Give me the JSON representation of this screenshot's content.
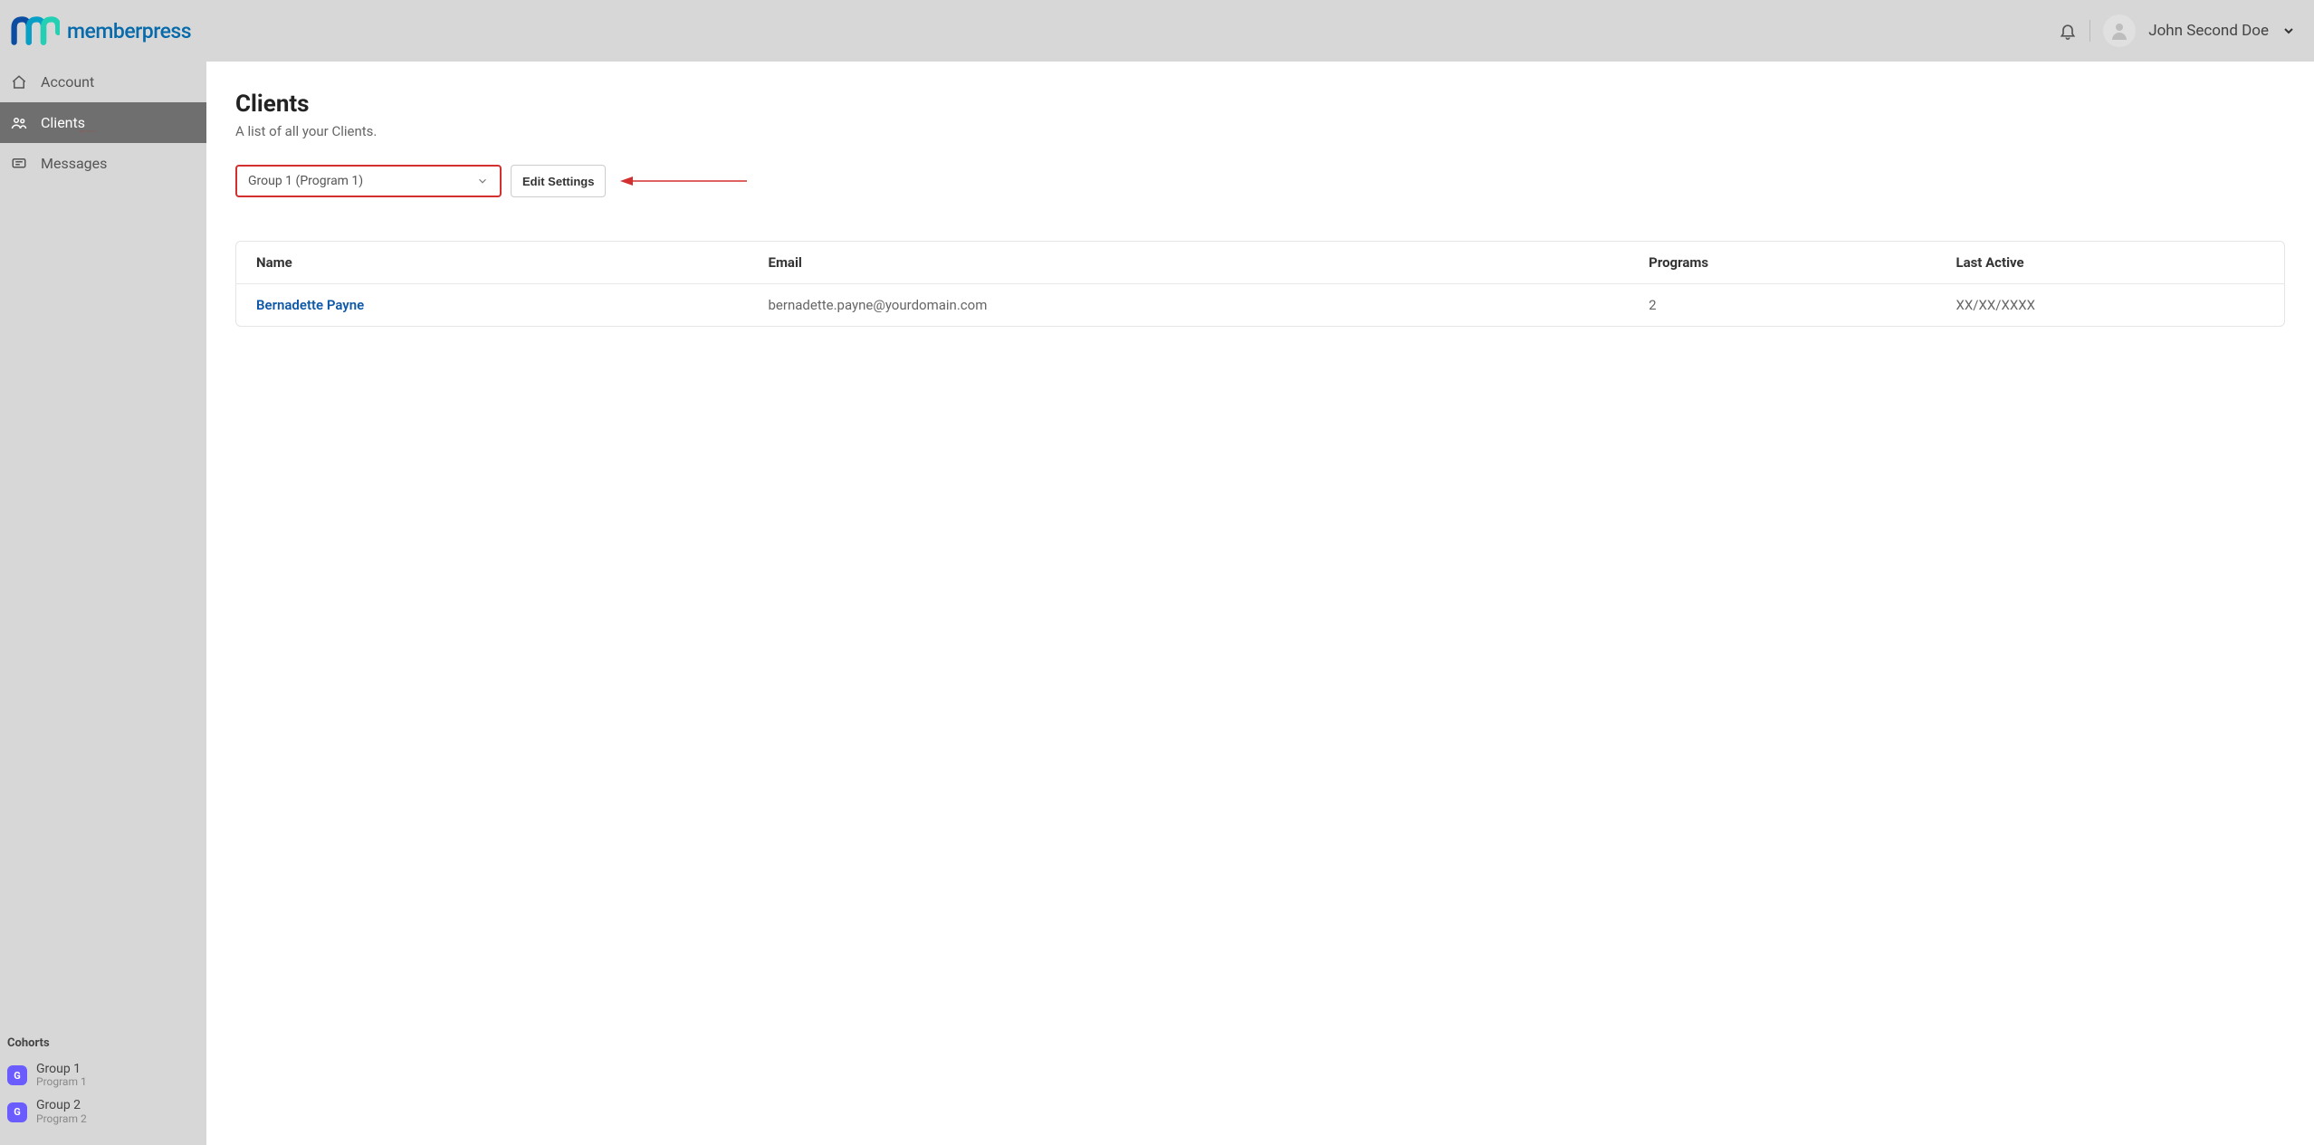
{
  "brand": {
    "name": "memberpress"
  },
  "user": {
    "display_name": "John Second Doe"
  },
  "sidebar": {
    "nav": [
      {
        "label": "Account",
        "icon": "home"
      },
      {
        "label": "Clients",
        "icon": "users"
      },
      {
        "label": "Messages",
        "icon": "message"
      }
    ],
    "active_index": 1,
    "cohorts_title": "Cohorts",
    "cohorts": [
      {
        "badge": "G",
        "name": "Group 1",
        "sub": "Program 1"
      },
      {
        "badge": "G",
        "name": "Group 2",
        "sub": "Program 2"
      }
    ]
  },
  "page": {
    "title": "Clients",
    "subtitle": "A list of all your Clients."
  },
  "controls": {
    "group_selected": "Group 1 (Program 1)",
    "edit_label": "Edit Settings"
  },
  "table": {
    "headers": {
      "name": "Name",
      "email": "Email",
      "programs": "Programs",
      "last_active": "Last Active"
    },
    "rows": [
      {
        "name": "Bernadette Payne",
        "email": "bernadette.payne@yourdomain.com",
        "programs": "2",
        "last_active": "XX/XX/XXXX"
      }
    ]
  },
  "annotation": {
    "arrow_color": "#d32f2f"
  }
}
